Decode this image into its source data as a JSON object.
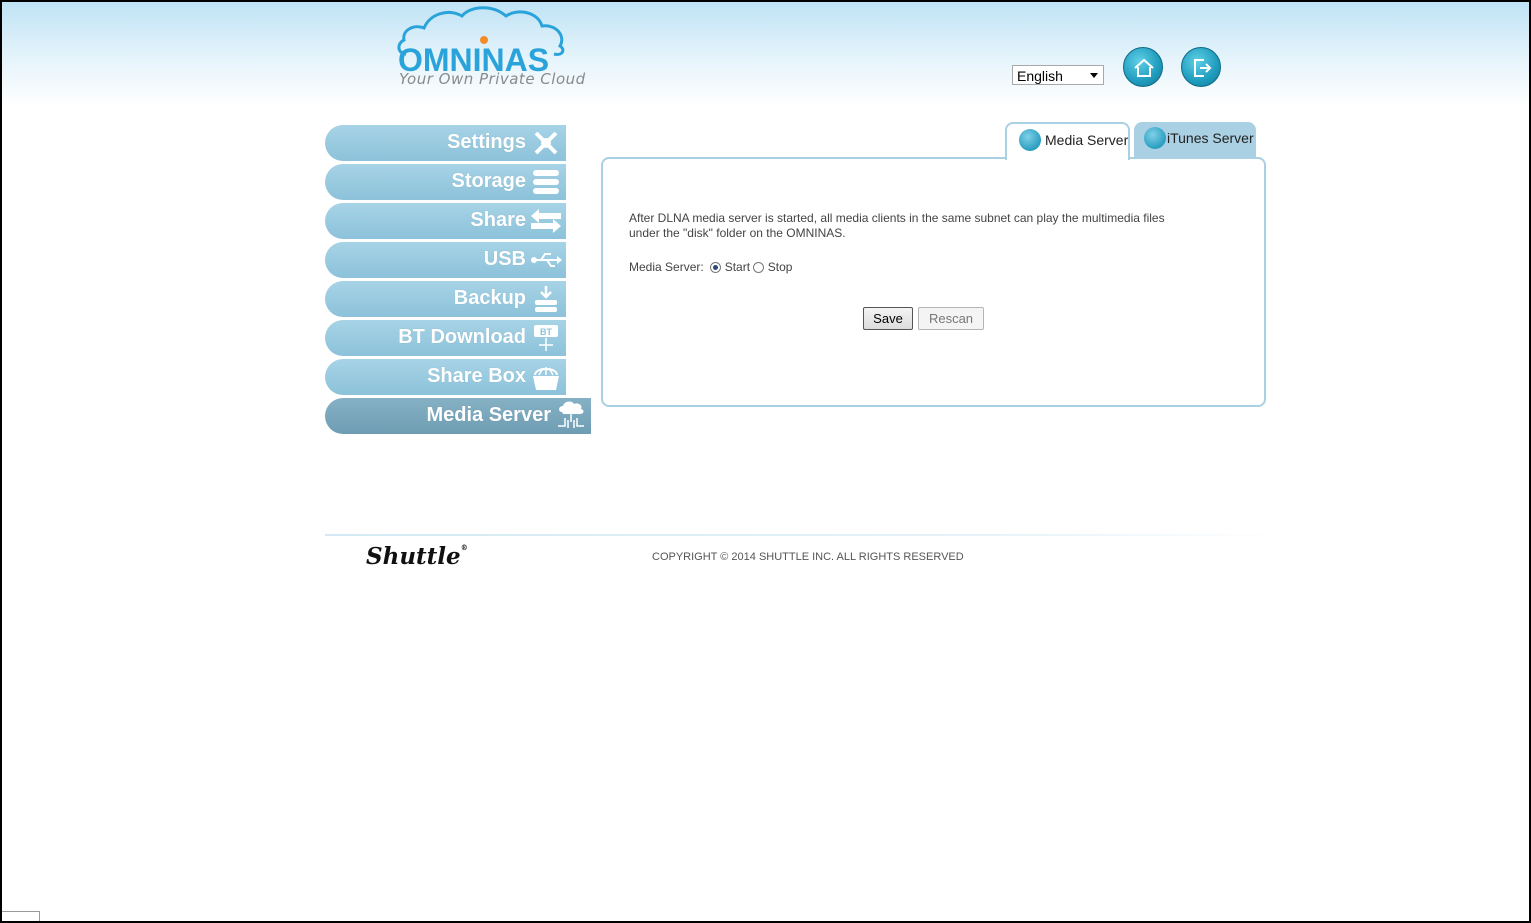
{
  "header": {
    "logo_text": "OMNINAS",
    "logo_tagline": "Your Own Private Cloud",
    "language": {
      "selected": "English"
    },
    "home_button_icon": "home-icon",
    "logout_button_icon": "logout-icon"
  },
  "sidebar": {
    "items": [
      {
        "label": "Settings",
        "icon": "tools-icon"
      },
      {
        "label": "Storage",
        "icon": "storage-icon"
      },
      {
        "label": "Share",
        "icon": "share-arrows-icon"
      },
      {
        "label": "USB",
        "icon": "usb-icon"
      },
      {
        "label": "Backup",
        "icon": "backup-icon"
      },
      {
        "label": "BT Download",
        "icon": "bt-download-icon"
      },
      {
        "label": "Share Box",
        "icon": "share-box-icon"
      },
      {
        "label": "Media Server",
        "icon": "media-server-icon",
        "active": true
      }
    ]
  },
  "tabs": [
    {
      "label": "Media Server",
      "icon": "media-globe-icon",
      "active": true
    },
    {
      "label": "iTunes Server",
      "icon": "music-note-icon",
      "active": false
    }
  ],
  "content": {
    "description_line1": "After DLNA media server is started, all media clients in the same subnet can play the multimedia files",
    "description_line2": "under the \"disk\" folder on the OMNINAS.",
    "media_server_label": "Media Server:",
    "option_start": "Start",
    "option_stop": "Stop",
    "selected_option": "Start",
    "save_label": "Save",
    "rescan_label": "Rescan"
  },
  "footer": {
    "brand": "Shuttle",
    "copyright": "COPYRIGHT © 2014 SHUTTLE INC. ALL RIGHTS RESERVED"
  },
  "colors": {
    "accent": "#2aa3db",
    "nav_bg": "#a7d3e6",
    "nav_active_bg": "#7ea9bd",
    "panel_border": "#a9d0e3"
  }
}
